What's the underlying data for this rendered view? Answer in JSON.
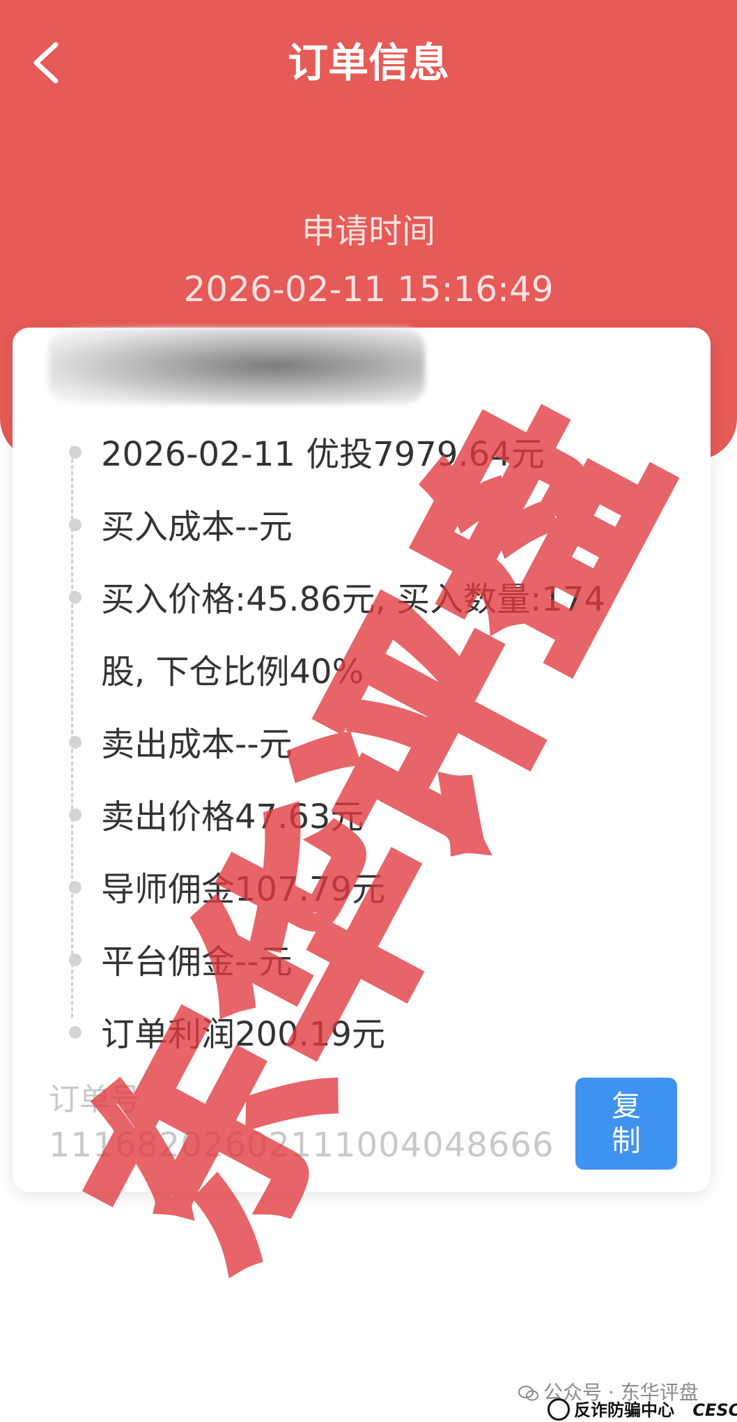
{
  "header": {
    "title": "订单信息",
    "apply_label": "申请时间",
    "apply_time": "2026-02-11 15:16:49"
  },
  "items": [
    "2026-02-11 优投7979.64元",
    "买入成本--元",
    "买入价格:45.86元, 买入数量:174",
    "股, 下仓比例40%",
    "卖出成本--元",
    "卖出价格47.63元",
    "导师佣金107.79元",
    "平台佣金--元",
    "订单利润200.19元"
  ],
  "order": {
    "label": "订单号",
    "number": "11168202602111004048666",
    "copy_label": "复制"
  },
  "watermark": {
    "text": "东华评盘",
    "color": "#e0393e"
  },
  "footer": {
    "wechat": "公众号 · 东华评盘",
    "brand": "反诈防骗中心",
    "brand_domain": "CESC.CC"
  },
  "colors": {
    "header_bg": "#e65a57",
    "copy_button": "#3f93f0"
  }
}
